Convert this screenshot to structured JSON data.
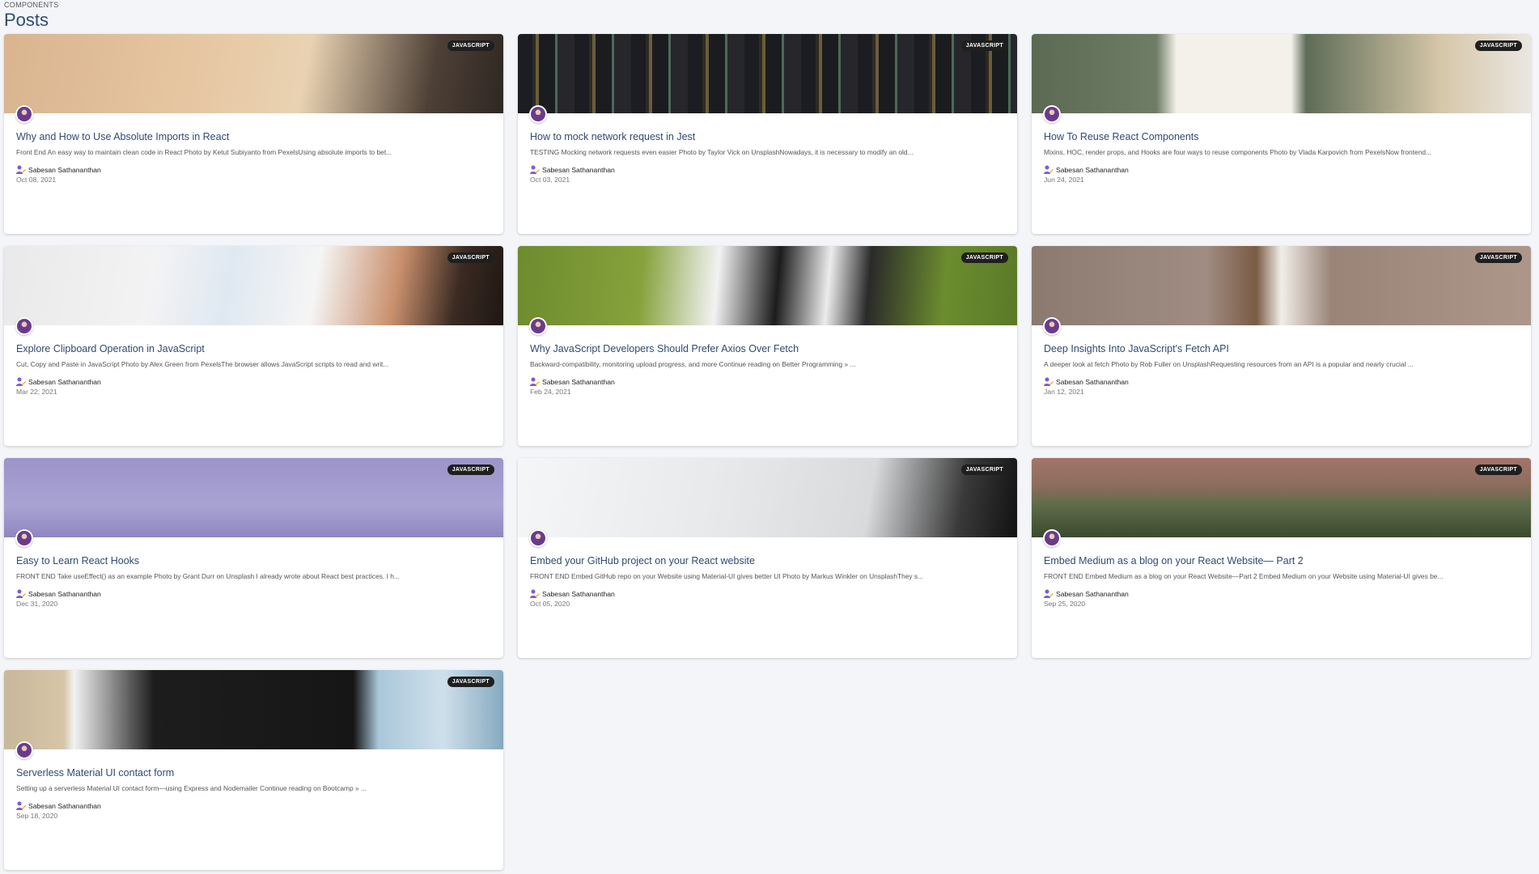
{
  "breadcrumb": "COMPONENTS",
  "page_title": "Posts",
  "colors": {
    "accent": "#2f4a73",
    "badge": "#1f1f1f",
    "background": "#f3f5f8"
  },
  "posts": [
    {
      "title": "Why and How to Use Absolute Imports in React",
      "excerpt": "Front End An easy way to maintain clean code in React Photo by Ketut Subiyanto from PexelsUsing absolute imports to bet...",
      "author": "Sabesan Sathananthan",
      "date": "Oct 08, 2021",
      "tag": "JAVASCRIPT",
      "image": "image-tape-on-box",
      "bg": "linear-gradient(100deg,#d9b48f 0%,#e7c7a3 40%,#e9d2b2 60%,#4e4036 85%,#2e2723 100%)"
    },
    {
      "title": "How to mock network request in Jest",
      "excerpt": "TESTING Mocking network requests even easier Photo by Taylor Vick on UnsplashNowadays, it is necessary to modify an old...",
      "author": "Sabesan Sathananthan",
      "date": "Oct 03, 2021",
      "tag": "JAVASCRIPT",
      "image": "image-server-cables",
      "bg": "repeating-linear-gradient(90deg,#1c1d22 0 18px,#2e2a24 18px 22px,#6b5d3b 22px 26px,#1b1c20 26px 46px,#4b6a5a 46px 49px,#26262b 49px 70px)"
    },
    {
      "title": "How To Reuse React Components",
      "excerpt": "Mixins, HOC, render props, and Hooks are four ways to reuse components Photo by Vlada Karpovich from PexelsNow frontend...",
      "author": "Sabesan Sathananthan",
      "date": "Jun 24, 2021",
      "tag": "JAVASCRIPT",
      "image": "image-reduce-reuse-card",
      "bg": "linear-gradient(90deg,#5c6a54 0%,#6f7d66 25%,#f4f1ea 29%,#f4f1ea 52%,#5e6c57 55%,#d6c7a8 82%,#eae7e1 100%)"
    },
    {
      "title": "Explore Clipboard Operation in JavaScript",
      "excerpt": "Cut, Copy and Paste in JavaScript Photo by Alex Green from PexelsThe browser allows JavaScript scripts to read and writ...",
      "author": "Sabesan Sathananthan",
      "date": "Mar 22, 2021",
      "tag": "JAVASCRIPT",
      "image": "image-calendar-desk",
      "bg": "linear-gradient(100deg,#e9e9ea 0%,#f3f3f4 30%,#dfe8f1 45%,#f5f5f5 62%,#c98f6c 78%,#3a2a22 90%,#1e1714 100%)"
    },
    {
      "title": "Why JavaScript Developers Should Prefer Axios Over Fetch",
      "excerpt": "Backward-compatibility, monitoring upload progress, and more Continue reading on Better Programming » ...",
      "author": "Sabesan Sathananthan",
      "date": "Feb 24, 2021",
      "tag": "JAVASCRIPT",
      "image": "image-dog-running",
      "bg": "linear-gradient(95deg,#6e8b2e 0%,#86a23c 25%,#f2f2f2 40%,#1c1c1c 52%,#ececec 62%,#2a2a2a 70%,#6c8c2f 85%,#5a7a28 100%)"
    },
    {
      "title": "Deep Insights Into JavaScript's Fetch API",
      "excerpt": "A deeper look at fetch Photo by Rob Fuller on UnsplashRequesting resources from an API is a popular and nearly crucial ...",
      "author": "Sabesan Sathananthan",
      "date": "Jan 12, 2021",
      "tag": "JAVASCRIPT",
      "image": "image-dog-with-stick",
      "bg": "linear-gradient(90deg,#8c7a70 0%,#a08c82 35%,#7a5b43 45%,#f1eee9 50%,#9a8478 60%,#ad978a 100%)"
    },
    {
      "title": "Easy to Learn React Hooks",
      "excerpt": "FRONT END Take useEffect() as an example Photo by Grant Durr on Unsplash I already wrote about React best practices. I h...",
      "author": "Sabesan Sathananthan",
      "date": "Dec 31, 2020",
      "tag": "JAVASCRIPT",
      "image": "image-rusty-hooks",
      "bg": "linear-gradient(180deg,#9c93c9 0%,#a9a3d3 60%,#8f86bf 100%)"
    },
    {
      "title": "Embed your GitHub project on your React website",
      "excerpt": "FRONT END Embed GitHub repo on your Website using Material-UI gives better UI Photo by Markus Winkler on UnsplashThey s...",
      "author": "Sabesan Sathananthan",
      "date": "Oct 05, 2020",
      "tag": "JAVASCRIPT",
      "image": "image-github-repo-screen",
      "bg": "linear-gradient(100deg,#f5f6f7 0%,#e7e9eb 40%,#d8dadc 70%,#3a3a3a 88%,#111 100%)"
    },
    {
      "title": "Embed Medium as a blog on your React Website— Part 2",
      "excerpt": "FRONT END Embed Medium as a blog on your React Website—Part 2 Embed Medium on your Website using Material-UI gives be...",
      "author": "Sabesan Sathananthan",
      "date": "Sep 25, 2020",
      "tag": "JAVASCRIPT",
      "image": "image-hourglass",
      "bg": "linear-gradient(180deg,#a3756a 0%,#8c6d5e 35%,#5e6b49 60%,#3b4a2e 100%)"
    },
    {
      "title": "Serverless Material UI contact form",
      "excerpt": "Setting up a serverless Material UI contact form—using Express and Nodemailer Continue reading on Bootcamp » ...",
      "author": "Sabesan Sathananthan",
      "date": "Sep 18, 2020",
      "tag": "JAVASCRIPT",
      "image": "image-form-on-tablet",
      "bg": "linear-gradient(90deg,#c9b79b 0%,#d7c5a8 12%,#f2f2f2 14%,#1d1d1d 30%,#161616 70%,#a9c7da 75%,#cfe0ea 88%,#86a9c0 100%)"
    }
  ]
}
